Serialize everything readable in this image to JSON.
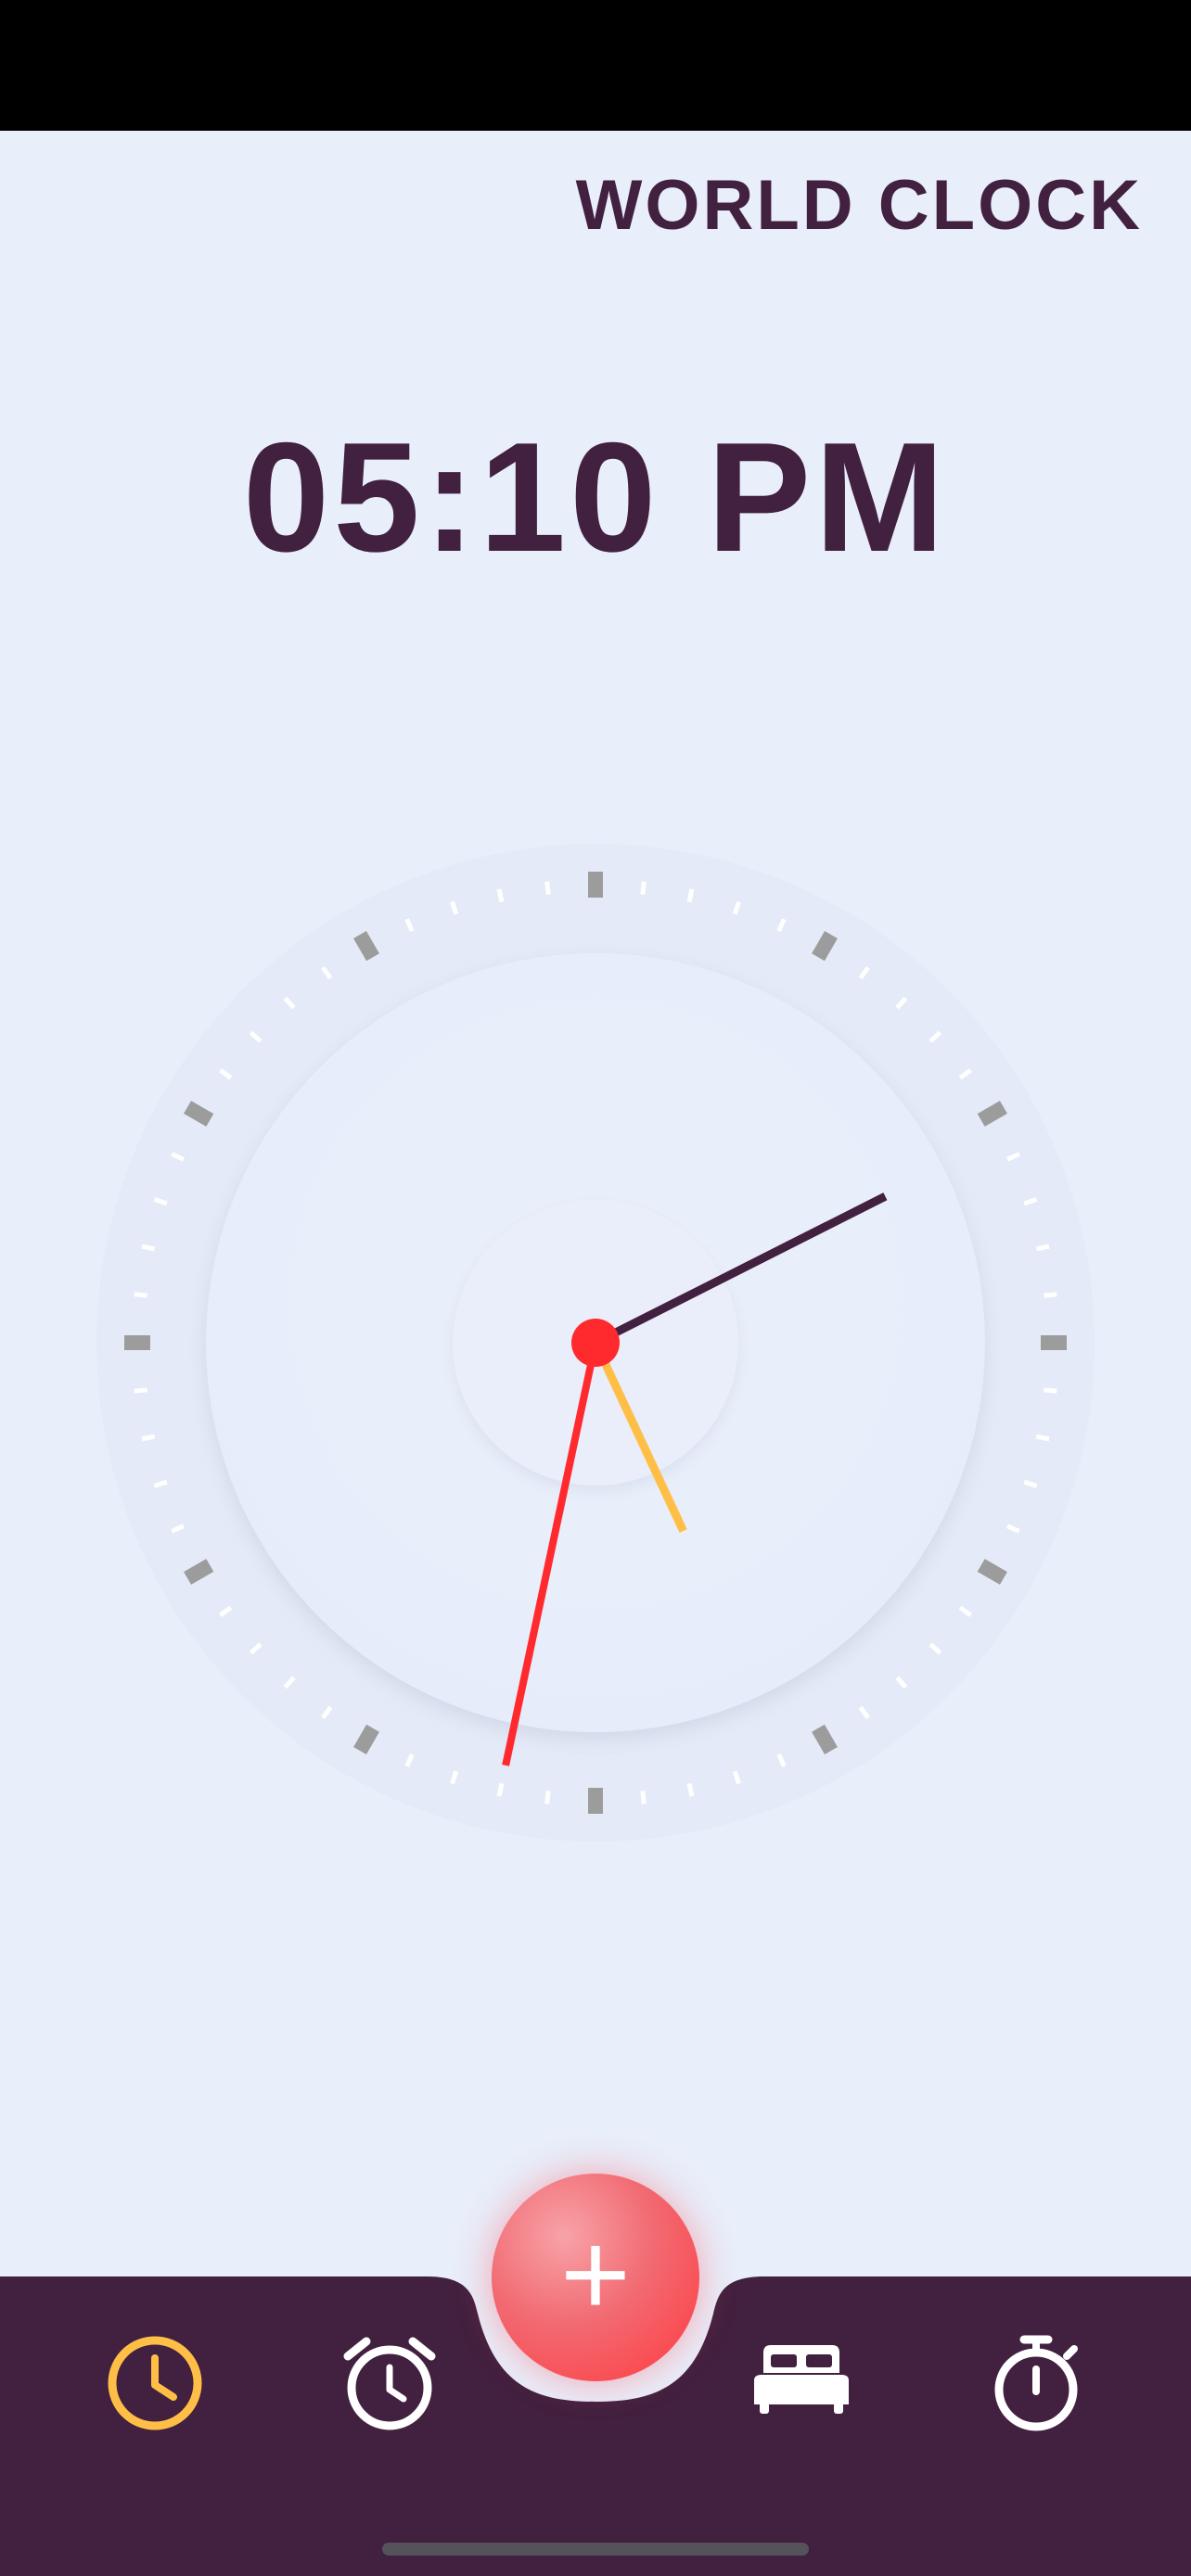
{
  "header": {
    "title": "WORLD CLOCK"
  },
  "clock": {
    "digital_time": "05:10 PM",
    "analog": {
      "hour": 5,
      "minute": 10,
      "second": 32
    },
    "colors": {
      "hour_hand": "#ffbf47",
      "minute_hand": "#42203f",
      "second_hand": "#ff2a2e",
      "major_tick": "#9c9c9c",
      "minor_tick": "#ffffff",
      "center_dot": "#ff2a2e"
    }
  },
  "fab": {
    "label": "+",
    "icon": "plus-icon"
  },
  "nav": {
    "background": "#42203f",
    "active_color": "#ffbf47",
    "inactive_color": "#ffffff",
    "items": [
      {
        "id": "world-clock",
        "icon": "clock-icon",
        "active": true
      },
      {
        "id": "alarm",
        "icon": "alarm-clock-icon",
        "active": false
      },
      {
        "id": "bedtime",
        "icon": "bed-icon",
        "active": false
      },
      {
        "id": "stopwatch",
        "icon": "stopwatch-icon",
        "active": false
      }
    ]
  }
}
